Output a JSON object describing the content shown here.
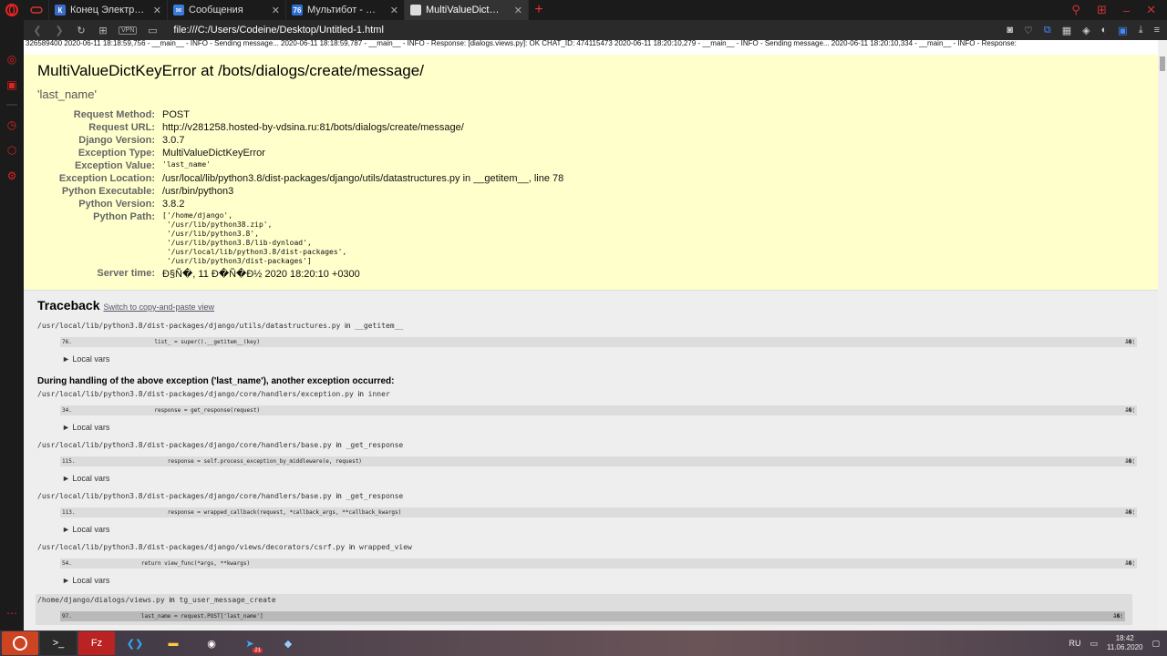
{
  "tabs": [
    {
      "label": "Конец Электроники - Сон",
      "color": "#3b6bc7",
      "glyph": "К"
    },
    {
      "label": "Сообщения",
      "color": "#3b7bd9",
      "glyph": "✉"
    },
    {
      "label": "Мультибот - CRM",
      "color": "#2b6fd4",
      "glyph": "76"
    },
    {
      "label": "MultiValueDictKeyError at /",
      "color": "#dddddd",
      "glyph": "",
      "active": true
    }
  ],
  "address": {
    "vpn": "VPN",
    "url": "file:///C:/Users/Codeine/Desktop/Untitled-1.html"
  },
  "log_lines": [
    "326589400 2020-06-11 18:18:59,756 - __main__ - INFO - Sending message... 2020-06-11 18:18:59,787 - __main__ - INFO - Response: [dialogs.views.py]: OK CHAT_ID: 474115473 2020-06-11 18:20:10,279 - __main__ - INFO - Sending message... 2020-06-11 18:20:10,334 - __main__ - INFO - Response:"
  ],
  "summary": {
    "title": "MultiValueDictKeyError at /bots/dialogs/create/message/",
    "exception_value": "'last_name'",
    "rows": [
      {
        "label": "Request Method:",
        "value": "POST"
      },
      {
        "label": "Request URL:",
        "value": "http://v281258.hosted-by-vdsina.ru:81/bots/dialogs/create/message/"
      },
      {
        "label": "Django Version:",
        "value": "3.0.7"
      },
      {
        "label": "Exception Type:",
        "value": "MultiValueDictKeyError"
      },
      {
        "label": "Exception Value:",
        "value": "'last_name'",
        "mono": true
      },
      {
        "label": "Exception Location:",
        "value": "/usr/local/lib/python3.8/dist-packages/django/utils/datastructures.py in __getitem__, line 78"
      },
      {
        "label": "Python Executable:",
        "value": "/usr/bin/python3"
      },
      {
        "label": "Python Version:",
        "value": "3.8.2"
      }
    ],
    "python_path_label": "Python Path:",
    "python_path": [
      "['/home/django',",
      " '/usr/lib/python38.zip',",
      " '/usr/lib/python3.8',",
      " '/usr/lib/python3.8/lib-dynload',",
      " '/usr/local/lib/python3.8/dist-packages',",
      " '/usr/lib/python3/dist-packages']"
    ],
    "server_time_label": "Server time:",
    "server_time": "Đ§Ñ�, 11 Đ�Ñ�Đ½ 2020 18:20:10 +0300"
  },
  "traceback": {
    "heading": "Traceback",
    "switch_link": "Switch to copy-and-paste view",
    "during": "During handling of the above exception ('last_name'), another exception occurred:",
    "local_vars": "► Local vars",
    "ellipsis": "â�¦",
    "in_word": "in",
    "frames_first": [
      {
        "path": "/usr/local/lib/python3.8/dist-packages/django/utils/datastructures.py",
        "func": "__getitem__",
        "line": "76.",
        "code": "            list_ = super().__getitem__(key)"
      }
    ],
    "frames_rest": [
      {
        "path": "/usr/local/lib/python3.8/dist-packages/django/core/handlers/exception.py",
        "func": "inner",
        "line": "34.",
        "code": "            response = get_response(request)"
      },
      {
        "path": "/usr/local/lib/python3.8/dist-packages/django/core/handlers/base.py",
        "func": "_get_response",
        "line": "115.",
        "code": "                response = self.process_exception_by_middleware(e, request)"
      },
      {
        "path": "/usr/local/lib/python3.8/dist-packages/django/core/handlers/base.py",
        "func": "_get_response",
        "line": "113.",
        "code": "                response = wrapped_callback(request, *callback_args, **callback_kwargs)"
      },
      {
        "path": "/usr/local/lib/python3.8/dist-packages/django/views/decorators/csrf.py",
        "func": "wrapped_view",
        "line": "54.",
        "code": "        return view_func(*args, **kwargs)"
      }
    ],
    "frame_user": {
      "path": "/home/django/dialogs/views.py",
      "func": "tg_user_message_create",
      "line": "97.",
      "code": "        last_name = request.POST['last_name']"
    }
  },
  "taskbar": {
    "lang": "RU",
    "time": "18:42",
    "date": "11.06.2020",
    "telegram_badge": "21"
  }
}
